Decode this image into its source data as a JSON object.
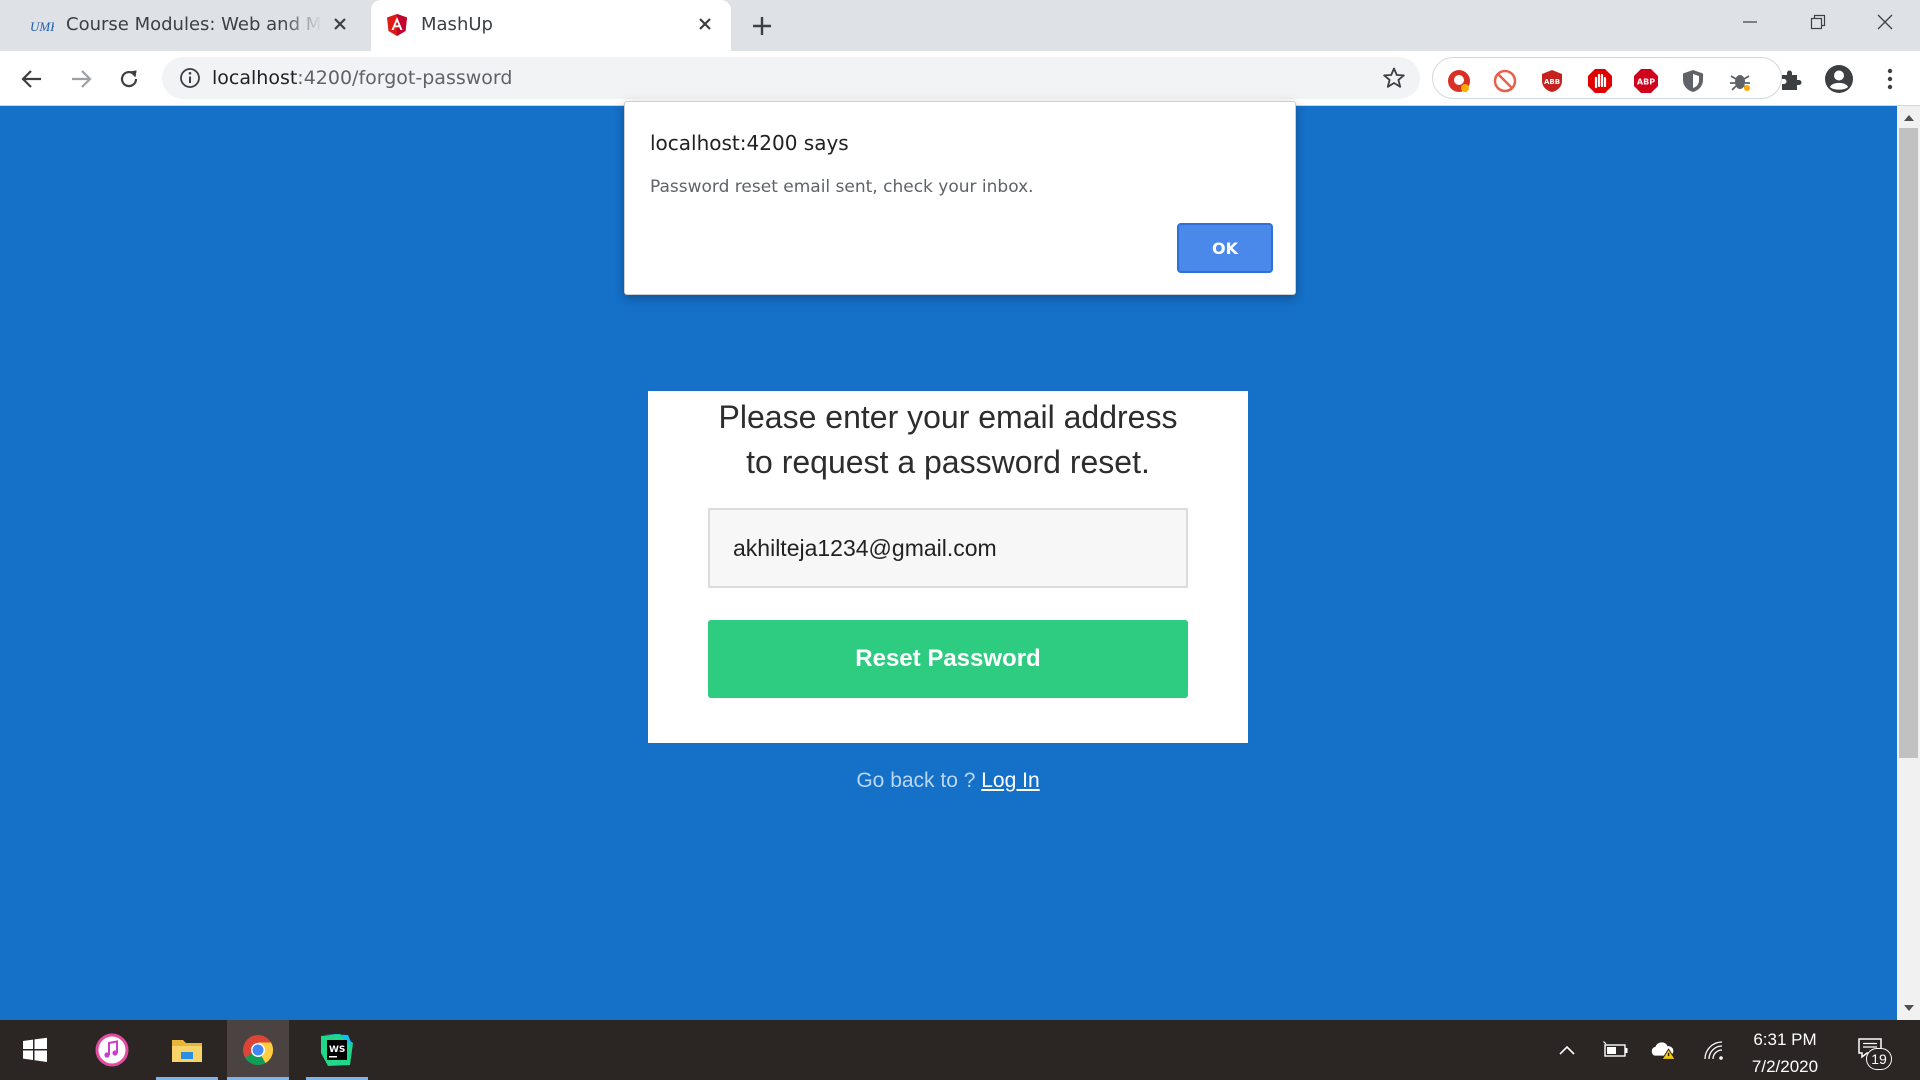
{
  "browser": {
    "tabs": [
      {
        "title": "Course Modules: Web and Mobile",
        "favicon": "umkc-logo-icon",
        "active": false
      },
      {
        "title": "MashUp",
        "favicon": "angular-logo-icon",
        "active": true
      }
    ],
    "address_bar": {
      "url_host": "localhost",
      "url_path": ":4200/forgot-password"
    },
    "extensions": [
      "extension-red-shield-icon",
      "extension-circle-slash-icon",
      "adblock-icon",
      "stop-hand-icon",
      "adblock-plus-icon",
      "shield-icon",
      "bug-extension-icon",
      "puzzle-icon"
    ]
  },
  "page": {
    "instructions_line1": "Please enter your email address",
    "instructions_line2": "to request a password reset.",
    "email_value": "akhilteja1234@gmail.com",
    "reset_button_label": "Reset Password",
    "back_text": "Go back to ? ",
    "login_link": "Log In",
    "colors": {
      "background": "#1570c8",
      "button": "#2ecc80"
    }
  },
  "alert": {
    "title": "localhost:4200 says",
    "message": "Password reset email sent, check your inbox.",
    "ok_label": "OK"
  },
  "taskbar": {
    "apps": [
      "windows-start-icon",
      "itunes-icon",
      "file-explorer-icon",
      "chrome-icon",
      "webstorm-icon"
    ],
    "time": "6:31 PM",
    "date": "7/2/2020",
    "notification_count": "19"
  }
}
